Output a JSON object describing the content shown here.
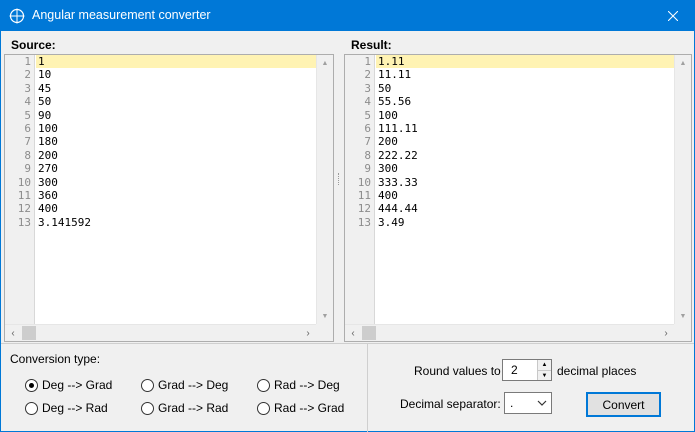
{
  "window": {
    "title": "Angular measurement converter"
  },
  "source": {
    "header": "Source:",
    "line_numbers": [
      "1",
      "2",
      "3",
      "4",
      "5",
      "6",
      "7",
      "8",
      "9",
      "10",
      "11",
      "12",
      "13"
    ],
    "lines": [
      "1",
      "10",
      "45",
      "50",
      "90",
      "100",
      "180",
      "200",
      "270",
      "300",
      "360",
      "400",
      "3.141592"
    ]
  },
  "result": {
    "header": "Result:",
    "line_numbers": [
      "1",
      "2",
      "3",
      "4",
      "5",
      "6",
      "7",
      "8",
      "9",
      "10",
      "11",
      "12",
      "13"
    ],
    "lines": [
      "1.11",
      "11.11",
      "50",
      "55.56",
      "100",
      "111.11",
      "200",
      "222.22",
      "300",
      "333.33",
      "400",
      "444.44",
      "3.49"
    ]
  },
  "conversion": {
    "label": "Conversion type:",
    "options": [
      {
        "label": "Deg --> Grad",
        "checked": true
      },
      {
        "label": "Grad --> Deg",
        "checked": false
      },
      {
        "label": "Rad --> Deg",
        "checked": false
      },
      {
        "label": "Deg --> Rad",
        "checked": false
      },
      {
        "label": "Grad --> Rad",
        "checked": false
      },
      {
        "label": "Rad --> Grad",
        "checked": false
      }
    ]
  },
  "options": {
    "round_label": "Round values to",
    "round_value": "2",
    "decimal_places_label": "decimal places",
    "separator_label": "Decimal separator:",
    "separator_value": ".",
    "convert_label": "Convert"
  },
  "icons": {
    "app": "crosshair-icon",
    "close": "close-icon",
    "scroll_up": "triangle-up-icon",
    "scroll_down": "triangle-down-icon",
    "scroll_left": "chevron-left-icon",
    "scroll_right": "chevron-right-icon",
    "dropdown": "chevron-down-icon"
  },
  "colors": {
    "titlebar": "#0078d7",
    "current_line": "#fff3b3",
    "accent": "#0078d7"
  }
}
